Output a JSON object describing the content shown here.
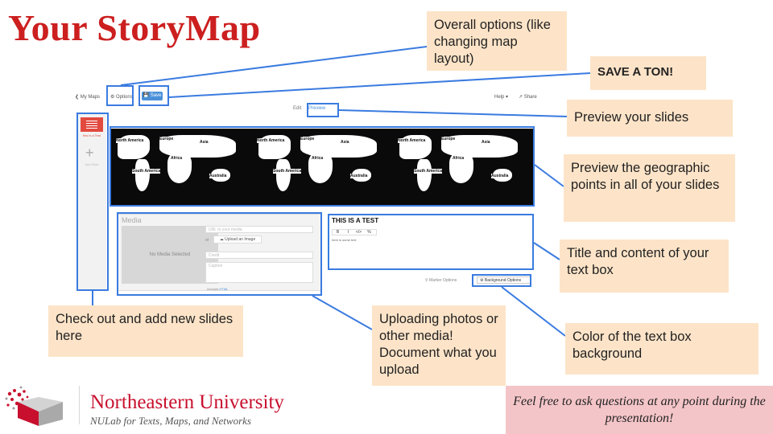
{
  "title": "Your StoryMap",
  "screenshot": {
    "my_maps": "❮ My Maps",
    "options": "⚙ Options",
    "save": "💾 Save",
    "help": "Help ▾",
    "share": "↗ Share",
    "tab_edit": "Edit",
    "tab_preview": "Preview",
    "slide_caption": "this is a Test",
    "add_slide": "Add Slide",
    "map_labels": {
      "north_america": "North America",
      "europe": "Europe",
      "asia": "Asia",
      "africa": "Africa",
      "south_america": "South America",
      "australia": "Australia"
    },
    "media": {
      "heading": "Media",
      "no_media": "No Media Selected",
      "url_placeholder": "URL to your media",
      "or": "or",
      "upload": "☁ Upload an Image",
      "credit_placeholder": "Credit",
      "caption_placeholder": "Caption",
      "accepts": "Accepts",
      "accepts_link": "HTML"
    },
    "textbox": {
      "title": "THIS IS A TEST",
      "tools": [
        "B",
        "I",
        "</>",
        "%"
      ],
      "body": "here is some text"
    },
    "marker_options": "⚲ Marker Options",
    "background_options": "⚙ Background Options"
  },
  "callouts": {
    "overall_options": "Overall options (like changing map layout)",
    "save": "SAVE A TON!",
    "preview_slides": "Preview your slides",
    "preview_points": "Preview the geographic points in all of your slides",
    "title_content": "Title and content of your text box",
    "add_slides": "Check out and add new slides here",
    "uploading": "Uploading photos or other media! Document what you upload",
    "color_bg": "Color of the text box background"
  },
  "footer": {
    "university": "Northeastern University",
    "lab": "NULab for Texts, Maps, and Networks",
    "questions": "Feel free to ask questions at any point during the presentation!"
  },
  "colors": {
    "title_red": "#cc1f1f",
    "highlight_blue": "#3a7be0",
    "callout_bg": "#fde4c8",
    "questions_bg": "#f4c5c8"
  }
}
